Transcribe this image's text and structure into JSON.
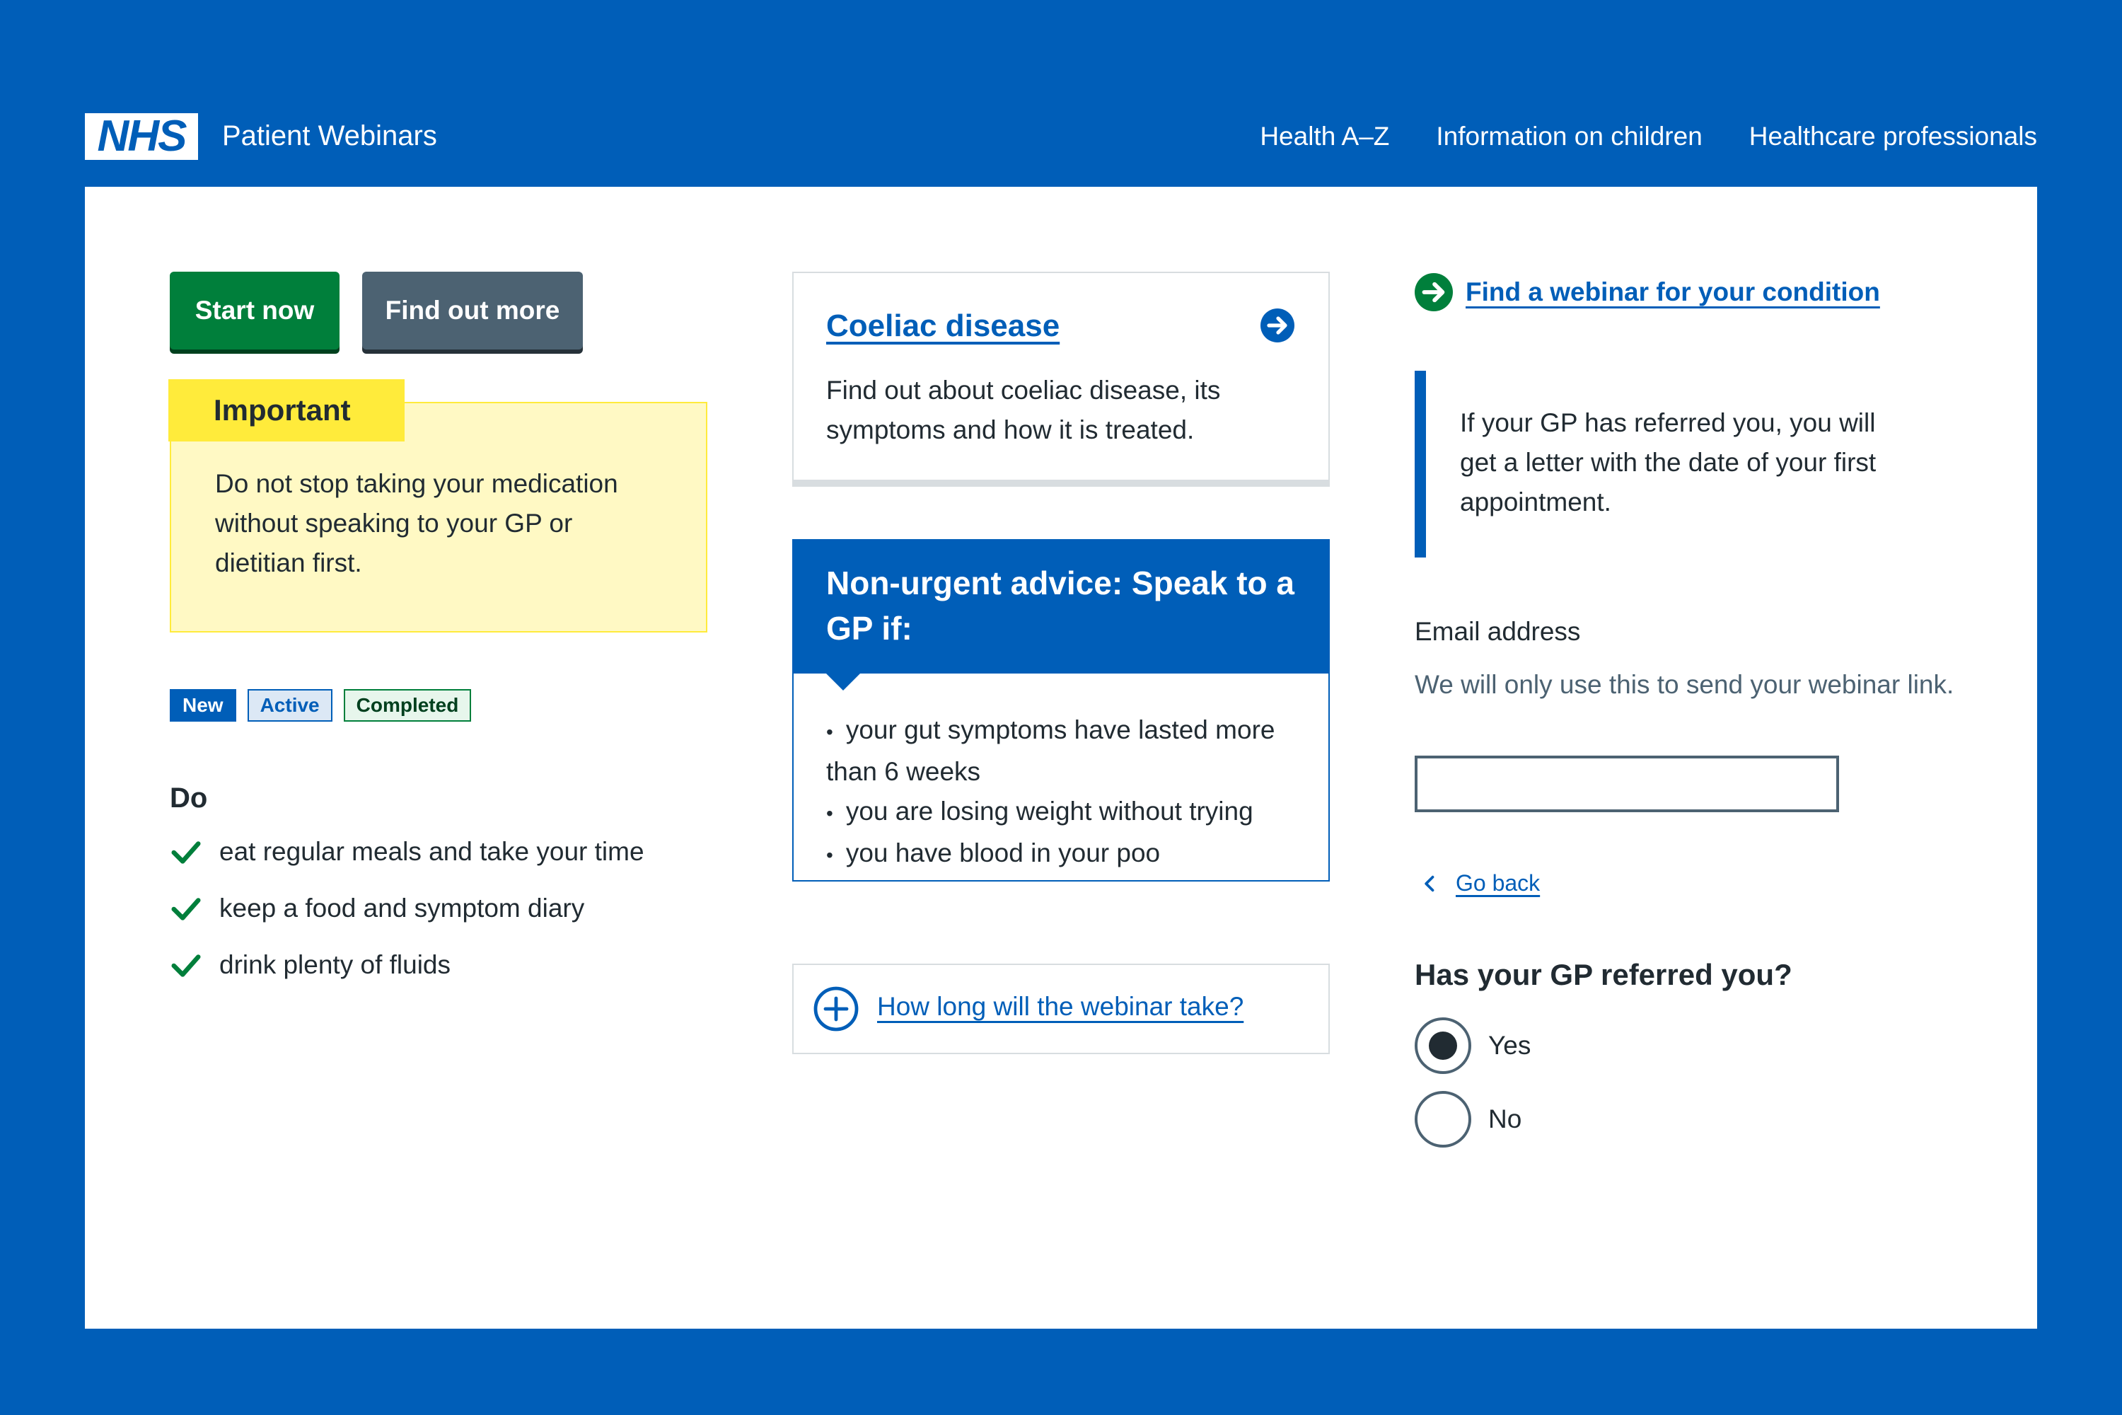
{
  "header": {
    "logo_text": "NHS",
    "service_name": "Patient Webinars",
    "nav": [
      {
        "label": "Health A–Z"
      },
      {
        "label": "Information on children"
      },
      {
        "label": "Healthcare professionals"
      }
    ]
  },
  "buttons": {
    "start_label": "Start now",
    "more_label": "Find out more"
  },
  "warning": {
    "label": "Important",
    "text": "Do not stop taking your medication without speaking to your GP or dietitian first."
  },
  "tags": [
    {
      "label": "New"
    },
    {
      "label": "Active"
    },
    {
      "label": "Completed"
    }
  ],
  "do_list": {
    "heading": "Do",
    "items": [
      "eat regular meals and take your time",
      "keep a food and symptom diary",
      "drink plenty of fluids"
    ]
  },
  "card": {
    "title": "Coeliac disease",
    "text": "Find out about coeliac disease, its symptoms and how it is treated."
  },
  "care_card": {
    "heading": "Non-urgent advice: Speak to a GP if:",
    "items": [
      "your gut symptoms have lasted more than 6 weeks",
      "you are losing weight without trying",
      "you have blood in your poo"
    ]
  },
  "details": {
    "summary": "How long will the webinar take?"
  },
  "action_link": {
    "label": "Find a webinar for your condition"
  },
  "inset": {
    "text": "If your GP has referred you, you will get a letter with the date of your first appointment."
  },
  "email": {
    "label": "Email address",
    "hint": "We will only use this to send your webinar link.",
    "value": ""
  },
  "back_link": {
    "label": "Go back"
  },
  "referral": {
    "legend": "Has your GP referred you?",
    "options": [
      {
        "label": "Yes",
        "selected": true
      },
      {
        "label": "No",
        "selected": false
      }
    ]
  },
  "colors": {
    "nhs_blue": "#005eb8",
    "nhs_green": "#007f3b",
    "grey": "#4c6272",
    "warm_yellow": "#ffeb3b",
    "text": "#212b32"
  }
}
